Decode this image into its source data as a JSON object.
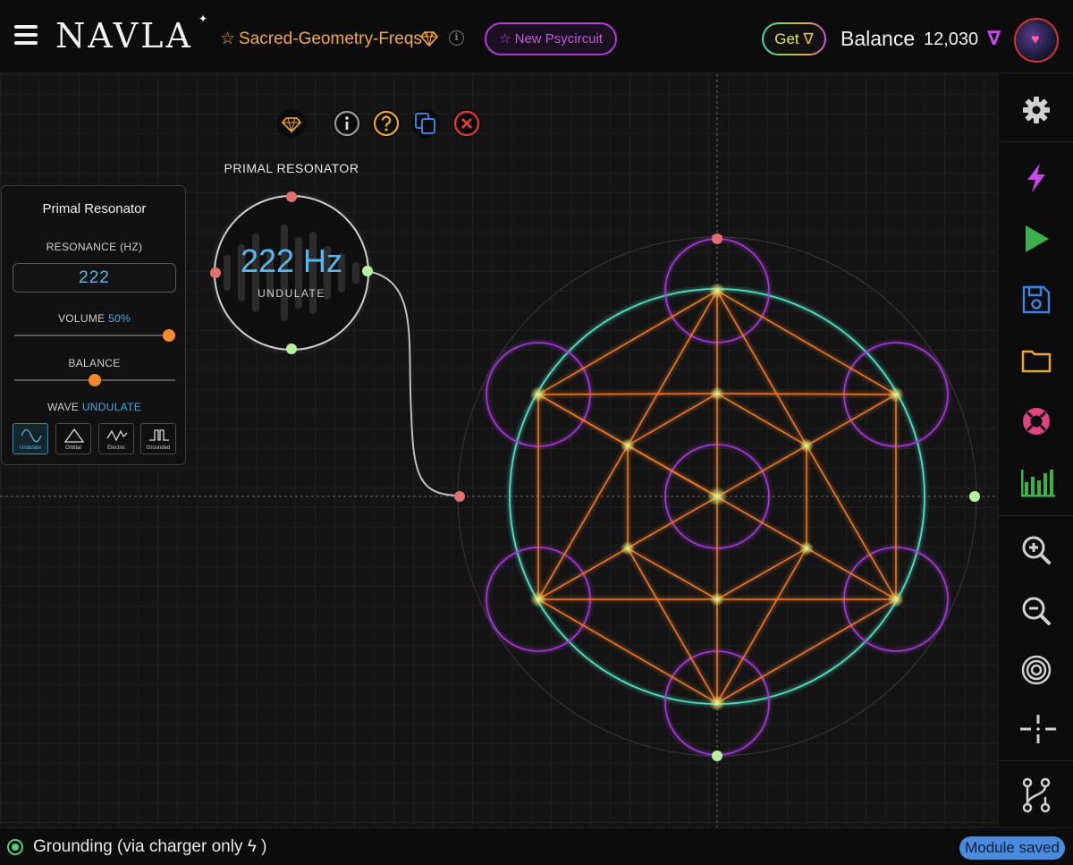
{
  "app": {
    "logo": "NAVLA",
    "logo_star": "✦"
  },
  "header": {
    "menu_icon": "hamburger-icon",
    "project_star": "☆",
    "project_title": "Sacred-Geometry-Freqs",
    "new_psycircuit_label": "New Psycircuit",
    "new_psycircuit_star": "☆",
    "get_label": "Get",
    "get_symbol": "∇",
    "balance_label": "Balance",
    "balance_value": "12,030",
    "balance_symbol": "∇",
    "info_symbol": "i"
  },
  "node": {
    "title": "PRIMAL RESONATOR",
    "frequency": "222 Hz",
    "wave_label": "UNDULATE"
  },
  "node_toolbar": {
    "icons": [
      "gem-icon",
      "info-icon",
      "help-icon",
      "duplicate-icon",
      "delete-icon"
    ]
  },
  "panel": {
    "title": "Primal Resonator",
    "resonance_label": "RESONANCE (HZ)",
    "resonance_value": "222",
    "volume_label": "VOLUME",
    "volume_value": "50%",
    "volume_level": 1.0,
    "balance_label": "BALANCE",
    "balance_level": 0.5,
    "wave_label": "WAVE",
    "wave_value": "UNDULATE",
    "waves": [
      "Undulate",
      "Orbital",
      "Electric",
      "Grounded"
    ],
    "active_wave": "Undulate"
  },
  "sidebar": {
    "items": [
      "gear-icon",
      "lightning-icon",
      "play-icon",
      "save-icon",
      "folder-icon",
      "lifebuoy-icon",
      "bar-chart-icon",
      "zoom-in-icon",
      "zoom-out-icon",
      "target-icon",
      "center-crosshair-icon",
      "graph-nodes-icon"
    ]
  },
  "status": {
    "grounding_text": "Grounding (via charger only",
    "grounding_bolt": "ϟ",
    "grounding_close": ")",
    "toast": "Module saved"
  },
  "colors": {
    "accent_orange": "#f4a93a",
    "accent_purple": "#c25ae0",
    "accent_teal": "#4fe0c0",
    "node_blue": "#5bb7ea",
    "port_red": "#e07070",
    "port_green": "#b6f0a0"
  }
}
